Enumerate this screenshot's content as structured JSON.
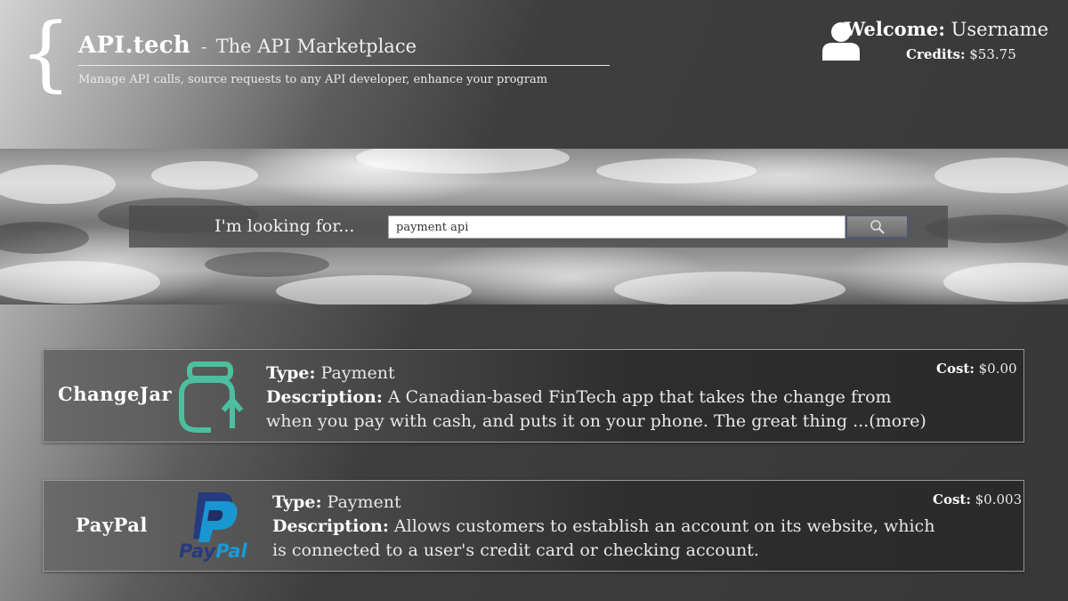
{
  "header": {
    "brand": "API.tech",
    "separator": "-",
    "tagline": "The API Marketplace",
    "subtitle": "Manage API calls, source requests to any API developer, enhance your program"
  },
  "user": {
    "welcome_label": "Welcome:",
    "username": "Username",
    "credits_label": "Credits:",
    "credits_value": "$53.75"
  },
  "search": {
    "label": "I'm looking for...",
    "value": "payment api"
  },
  "results": [
    {
      "name": "ChangeJar",
      "type_label": "Type:",
      "type": "Payment",
      "desc_label": "Description:",
      "description": "A Canadian-based FinTech app that takes the change from when you pay with cash, and puts it on your phone. The great thing ...",
      "more": "(more)",
      "cost_label": "Cost:",
      "cost": "$0.00",
      "logo_icon": "changejar-jar-icon"
    },
    {
      "name": "PayPal",
      "type_label": "Type:",
      "type": "Payment",
      "desc_label": "Description:",
      "description": "Allows customers to establish an account on its website, which is connected to a user's credit card or checking account.",
      "cost_label": "Cost:",
      "cost": "$0.003",
      "logo_icon": "paypal-logo-icon",
      "logo_text": "PayPal"
    }
  ],
  "colors": {
    "changejar_teal": "#4cbfa0",
    "paypal_dark_blue": "#253b80",
    "paypal_light_blue": "#179bd7",
    "search_button_border": "#4b5a72"
  }
}
